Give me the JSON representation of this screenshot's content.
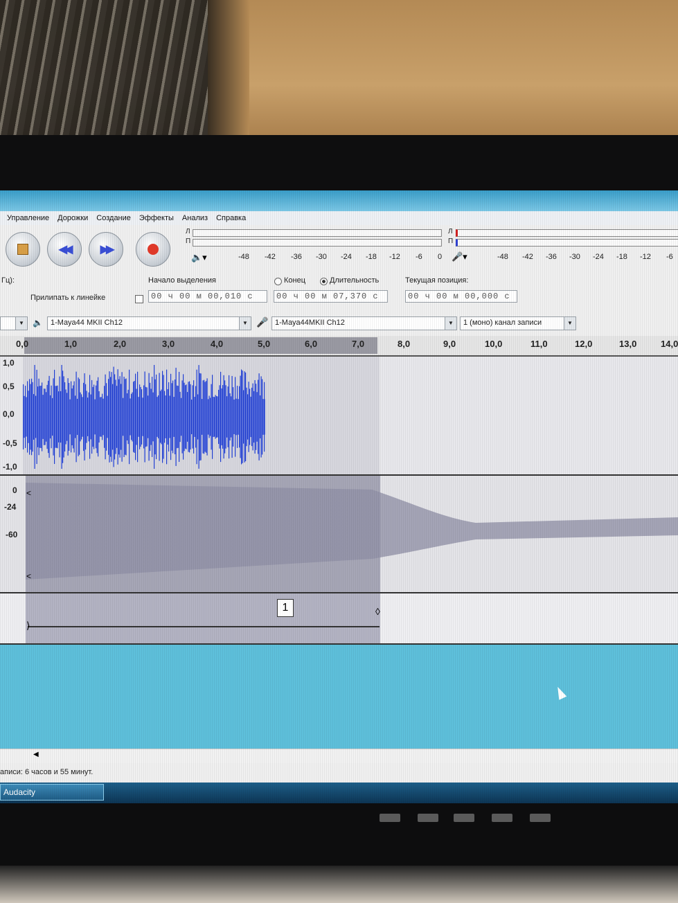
{
  "menu": {
    "items": [
      "Управление",
      "Дорожки",
      "Создание",
      "Эффекты",
      "Анализ",
      "Справка"
    ]
  },
  "meters": {
    "play_left": "Л",
    "play_right": "П",
    "rec_left": "Л",
    "rec_right": "П",
    "play_ticks": [
      "-48",
      "-42",
      "-36",
      "-30",
      "-24",
      "-18",
      "-12",
      "-6",
      "0"
    ],
    "rec_ticks": [
      "-48",
      "-42",
      "-36",
      "-30",
      "-24",
      "-18",
      "-12",
      "-6"
    ]
  },
  "selection": {
    "rate_label": "Гц):",
    "snap_label": "Прилипать к линейке",
    "start_label": "Начало выделения",
    "end_label": "Конец",
    "length_label": "Длительность",
    "position_label": "Текущая позиция:",
    "start_value": "00 ч 00 м 00,010 с",
    "length_value": "00 ч 00 м 07,370 с",
    "position_value": "00 ч 00 м 00,000 с"
  },
  "devices": {
    "output": "1-Maya44 MKII Ch12",
    "input": "1-Maya44MKII Ch12",
    "channels": "1 (моно) канал записи"
  },
  "ruler": {
    "ticks": [
      "0,0",
      "1,0",
      "2,0",
      "3,0",
      "4,0",
      "5,0",
      "6,0",
      "7,0",
      "8,0",
      "9,0",
      "10,0",
      "11,0",
      "12,0",
      "13,0",
      "14,0"
    ]
  },
  "track1": {
    "y_labels": [
      "1,0",
      "0,5",
      "0,0",
      "-0,5",
      "-1,0"
    ]
  },
  "track2": {
    "y_labels": [
      "0",
      "-24",
      "-60"
    ]
  },
  "label_track": {
    "label_text": "1"
  },
  "status": {
    "text": "аписи: 6 часов и 55 минут."
  },
  "taskbar": {
    "app": "Audacity"
  },
  "colors": {
    "waveform": "#1f3fd8",
    "selection": "#d7d7de",
    "taskbar": "#1d5f8a"
  }
}
